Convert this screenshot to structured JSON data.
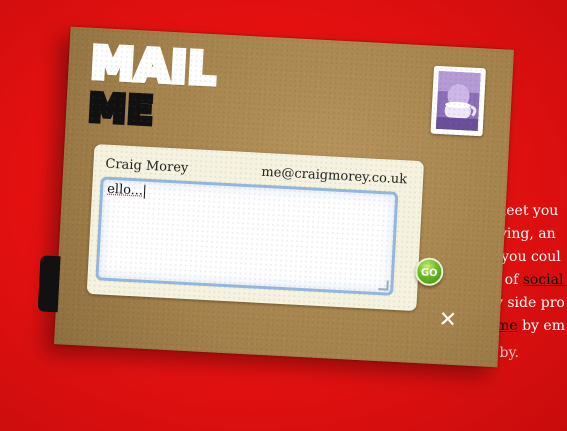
{
  "background_text": {
    "lines": [
      {
        "pre": "",
        "text": "meet you",
        "link": "",
        "post": ""
      },
      {
        "pre": "",
        "text": "living, an",
        "link": "",
        "post": ""
      },
      {
        "pre": "",
        "text": "r you coul",
        "link": "",
        "post": ""
      },
      {
        "pre": "s of ",
        "text": "",
        "link": "social s",
        "post": ""
      },
      {
        "pre": "",
        "text": "ny side pro",
        "link": "",
        "post": ""
      },
      {
        "pre": "",
        "text": "",
        "link": "t me",
        "post": " by em"
      }
    ],
    "thanks": "Thanks for dropping by."
  },
  "card": {
    "logo_line1": "MAIL",
    "logo_line2": "ME",
    "avatar_icon": "profile-photo"
  },
  "form": {
    "name": "Craig Morey",
    "email": "me@craigmorey.co.uk",
    "message_value": "ello..."
  },
  "buttons": {
    "go_label": "GO",
    "close_label": "✕"
  },
  "colors": {
    "background": "#e81111",
    "card": "#a4824c",
    "textarea_border": "#93b6dc",
    "go_button": "#6cbb24"
  }
}
